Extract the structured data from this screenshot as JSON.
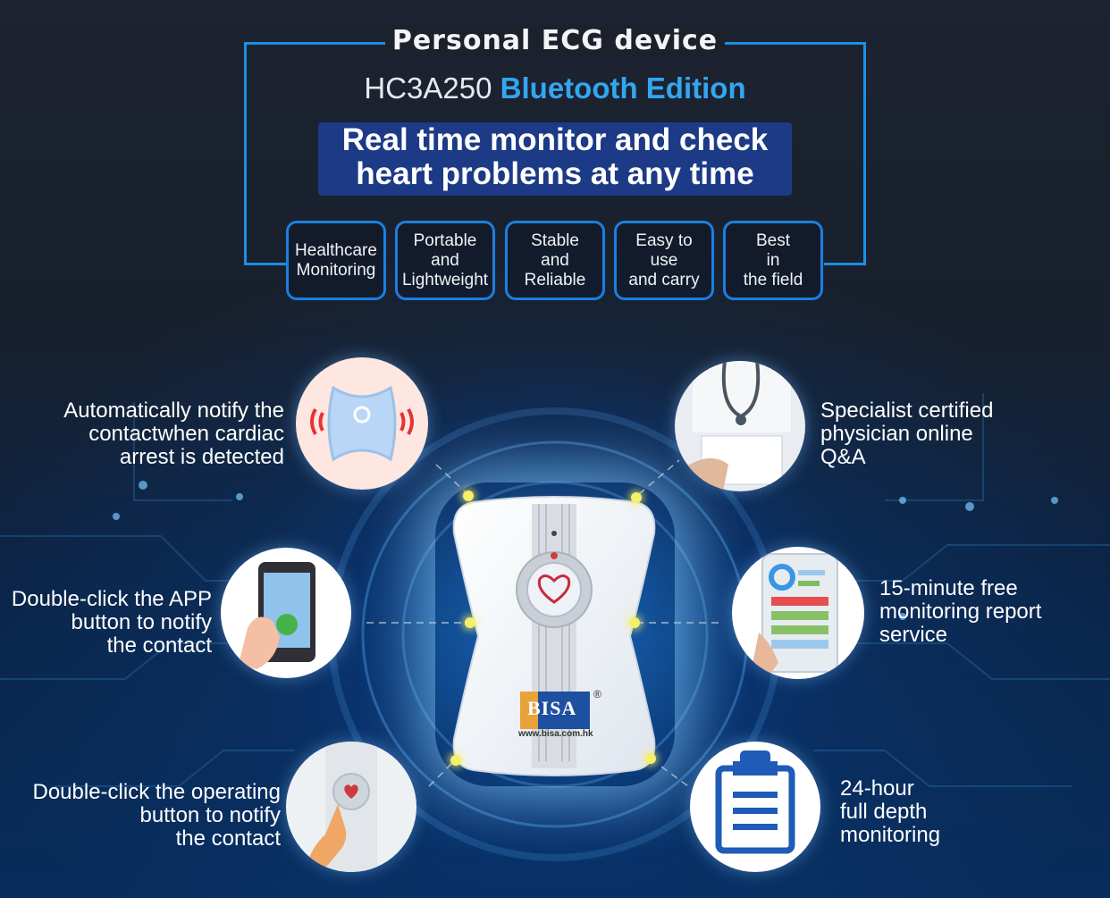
{
  "header": {
    "title": "Personal ECG device",
    "model": "HC3A250",
    "edition": "Bluetooth Edition",
    "tagline_line1": "Real time monitor and check",
    "tagline_line2": "heart problems at any time"
  },
  "chips": [
    {
      "label": "Healthcare\nMonitoring"
    },
    {
      "label": "Portable\nand\nLightweight"
    },
    {
      "label": "Stable\nand\nReliable"
    },
    {
      "label": "Easy to\nuse\nand carry"
    },
    {
      "label": "Best\nin\nthe field"
    }
  ],
  "features": {
    "left_top": "Automatically notify the\ncontactwhen cardiac\narrest is detected",
    "left_mid": "Double-click the APP\nbutton to notify\nthe contact",
    "left_bottom": "Double-click the operating\nbutton to notify\nthe contact",
    "right_top": "Specialist certified\nphysician online\nQ&A",
    "right_mid": "15-minute free\nmonitoring report\nservice",
    "right_bottom": "24-hour\nfull depth\nmonitoring"
  },
  "device": {
    "brand": "BISA",
    "url": "www.bisa.com.hk",
    "registered": "®"
  },
  "colors": {
    "accent_blue": "#1d7ee0",
    "edition_blue": "#33a6ef",
    "tagline_bg": "#1d3a86",
    "glow_yellow": "#f4f06a"
  },
  "icons": {
    "notify": "ecg-patch-signal-icon",
    "doctor": "stethoscope-doctor-icon",
    "app": "phone-hand-icon",
    "report": "phone-report-icon",
    "button": "finger-press-icon",
    "clipboard": "clipboard-icon"
  }
}
